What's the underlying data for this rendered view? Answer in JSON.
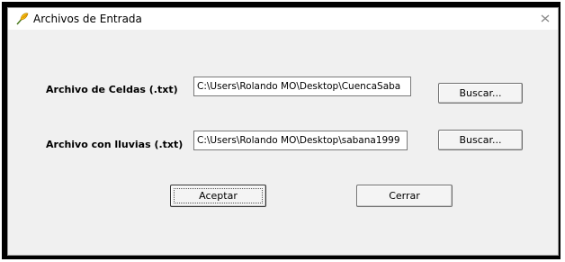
{
  "window": {
    "title": "Archivos de Entrada",
    "icon": "feather-app-icon",
    "close_icon": "close-icon"
  },
  "form": {
    "celdas_label": "Archivo de Celdas (.txt)",
    "celdas_value": "C:\\Users\\Rolando MO\\Desktop\\CuencaSaba",
    "lluvias_label": "Archivo con lluvias (.txt)",
    "lluvias_value": "C:\\Users\\Rolando MO\\Desktop\\sabana1999",
    "buscar1_label": "Buscar...",
    "buscar2_label": "Buscar...",
    "aceptar_label": "Aceptar",
    "cerrar_label": "Cerrar"
  }
}
